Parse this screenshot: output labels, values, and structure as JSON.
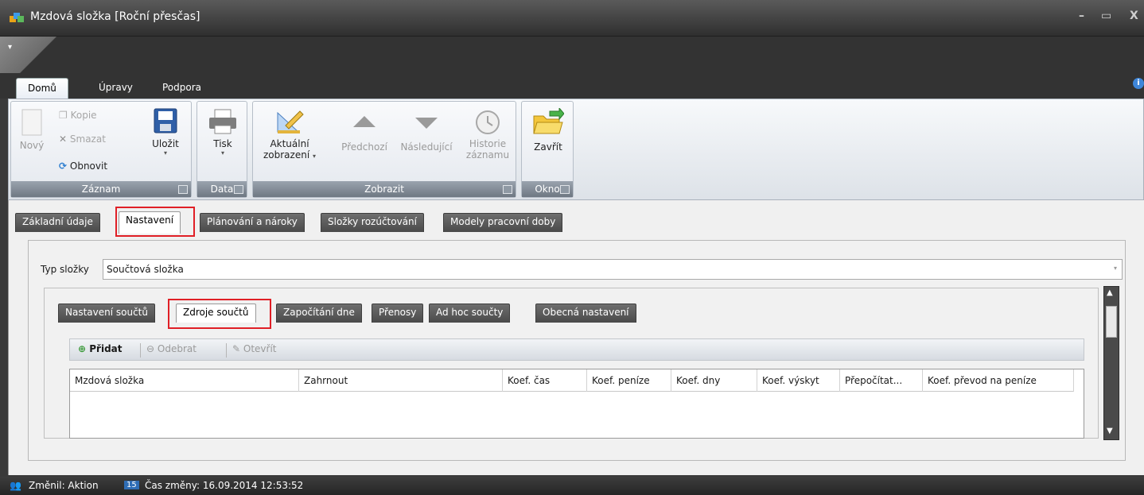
{
  "window": {
    "title": "Mzdová složka [Roční přesčas]",
    "minimize": "–",
    "maximize": "▭",
    "close": "X"
  },
  "ribbon_tabs": [
    {
      "label": "Domů",
      "active": true
    },
    {
      "label": "Úpravy",
      "active": false
    },
    {
      "label": "Podpora",
      "active": false
    }
  ],
  "ribbon": {
    "groups": {
      "zaznam": "Záznam",
      "data": "Data",
      "zobrazit": "Zobrazit",
      "okno": "Okno"
    },
    "buttons": {
      "novy": "Nový",
      "kopie": "Kopie",
      "smazat": "Smazat",
      "obnovit": "Obnovit",
      "ulozit": "Uložit",
      "tisk": "Tisk",
      "aktualni_1": "Aktuální",
      "aktualni_2": "zobrazení",
      "predchozi": "Předchozí",
      "nasledujici": "Následující",
      "historie_1": "Historie",
      "historie_2": "záznamu",
      "zavrit": "Zavřít"
    }
  },
  "form_tabs": [
    {
      "label": "Základní údaje",
      "active": false
    },
    {
      "label": "Nastavení",
      "active": true
    },
    {
      "label": "Plánování a nároky",
      "active": false
    },
    {
      "label": "Složky rozúčtování",
      "active": false
    },
    {
      "label": "Modely pracovní doby",
      "active": false
    }
  ],
  "typ_slozky": {
    "label": "Typ složky",
    "value": "Součtová složka"
  },
  "inner_tabs": [
    {
      "label": "Nastavení součtů",
      "active": false
    },
    {
      "label": "Zdroje součtů",
      "active": true
    },
    {
      "label": "Započítání dne",
      "active": false
    },
    {
      "label": "Přenosy",
      "active": false
    },
    {
      "label": "Ad hoc součty",
      "active": false
    },
    {
      "label": "Obecná nastavení",
      "active": false
    }
  ],
  "toolbar": {
    "pridat": "Přidat",
    "odebrat": "Odebrat",
    "otevrit": "Otevřít"
  },
  "grid": {
    "columns": [
      "Mzdová složka",
      "Zahrnout",
      "Koef. čas",
      "Koef. peníze",
      "Koef. dny",
      "Koef. výskyt",
      "Přepočítat...",
      "Koef. převod na peníze"
    ]
  },
  "status": {
    "changed_by": "Změnil: Aktion",
    "changed_time": "Čas změny: 16.09.2014 12:53:52"
  },
  "colors": {
    "highlight": "#e01f26",
    "dark_chrome": "#333333"
  }
}
